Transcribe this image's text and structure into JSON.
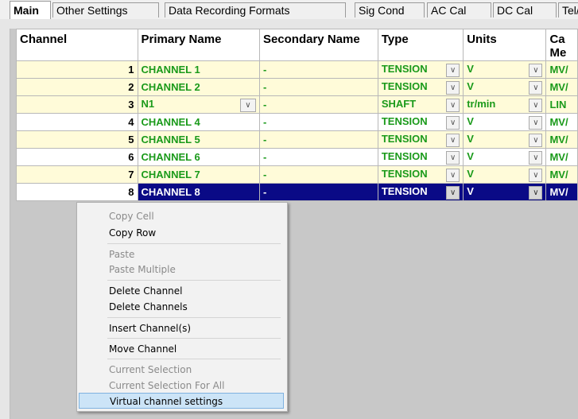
{
  "tabs": [
    {
      "label": "Main"
    },
    {
      "label": "Other Settings"
    },
    {
      "label": "Data Recording Formats"
    },
    {
      "label": "Sig Cond"
    },
    {
      "label": "AC Cal"
    },
    {
      "label": "DC Cal"
    },
    {
      "label": "Tel/"
    }
  ],
  "grid": {
    "headers": {
      "channel": "Channel",
      "primary": "Primary Name",
      "secondary": "Secondary Name",
      "type": "Type",
      "units": "Units",
      "cal": "Ca Me"
    },
    "rows": [
      {
        "channel": "1",
        "primary": "CHANNEL 1",
        "secondary": "-",
        "type": "TENSION",
        "units": "V",
        "cal": "MV/"
      },
      {
        "channel": "2",
        "primary": "CHANNEL 2",
        "secondary": "-",
        "type": "TENSION",
        "units": "V",
        "cal": "MV/"
      },
      {
        "channel": "3",
        "primary": "N1",
        "secondary": "-",
        "type": "SHAFT",
        "units": "tr/min",
        "cal": "LIN"
      },
      {
        "channel": "4",
        "primary": "CHANNEL 4",
        "secondary": "-",
        "type": "TENSION",
        "units": "V",
        "cal": "MV/"
      },
      {
        "channel": "5",
        "primary": "CHANNEL 5",
        "secondary": "-",
        "type": "TENSION",
        "units": "V",
        "cal": "MV/"
      },
      {
        "channel": "6",
        "primary": "CHANNEL 6",
        "secondary": "-",
        "type": "TENSION",
        "units": "V",
        "cal": "MV/"
      },
      {
        "channel": "7",
        "primary": "CHANNEL 7",
        "secondary": "-",
        "type": "TENSION",
        "units": "V",
        "cal": "MV/"
      },
      {
        "channel": "8",
        "primary": "CHANNEL 8",
        "secondary": "-",
        "type": "TENSION",
        "units": "V",
        "cal": "MV/"
      }
    ]
  },
  "context_menu": {
    "copy_cell": "Copy Cell",
    "copy_row": "Copy Row",
    "paste": "Paste",
    "paste_multiple": "Paste Multiple",
    "delete_channel": "Delete Channel",
    "delete_channels": "Delete Channels",
    "insert_channels": "Insert Channel(s)",
    "move_channel": "Move Channel",
    "current_selection": "Current Selection",
    "current_selection_all": "Current Selection For All",
    "virtual_channel_settings": "Virtual channel settings"
  },
  "colors": {
    "selected_row": "#0a0a86",
    "name_text": "#1a9a1a",
    "alt_row": "#fffbd9",
    "menu_highlight": "#cce4f7"
  }
}
